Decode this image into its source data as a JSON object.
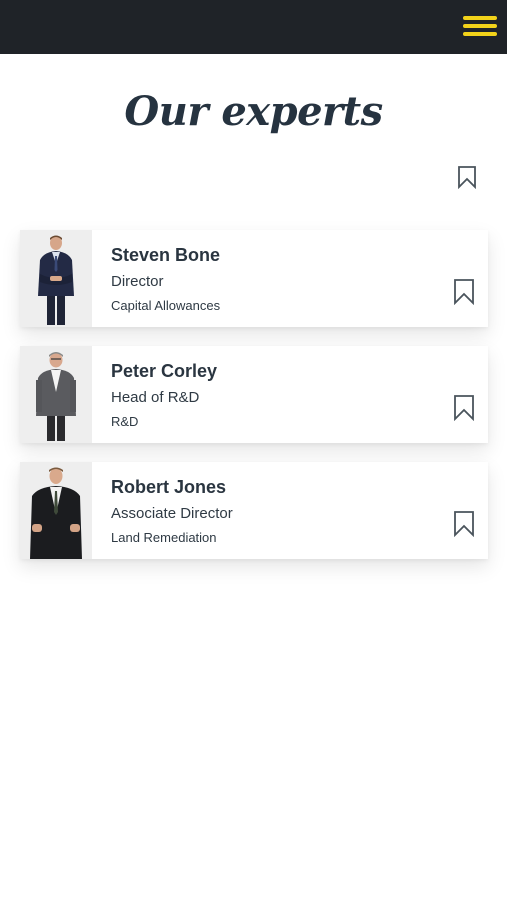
{
  "header": {
    "menu_icon": "hamburger-menu-icon",
    "accent_color": "#f2d21a",
    "background_color": "#1f2328"
  },
  "page": {
    "title": "Our experts",
    "bookmark_icon": "bookmark-icon"
  },
  "experts": [
    {
      "name": "Steven Bone",
      "role": "Director",
      "department": "Capital Allowances",
      "bookmark_icon": "bookmark-icon"
    },
    {
      "name": "Peter Corley",
      "role": "Head of R&D",
      "department": "R&D",
      "bookmark_icon": "bookmark-icon"
    },
    {
      "name": "Robert Jones",
      "role": "Associate Director",
      "department": "Land Remediation",
      "bookmark_icon": "bookmark-icon"
    }
  ]
}
